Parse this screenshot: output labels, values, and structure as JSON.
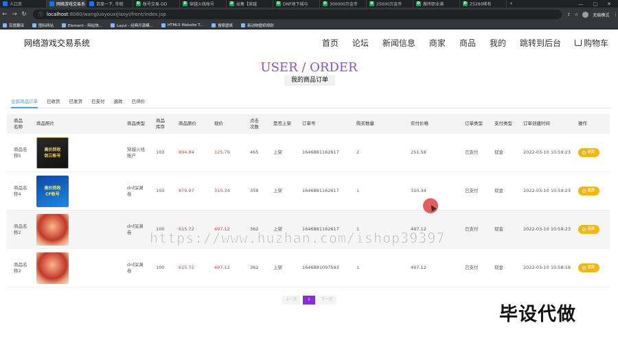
{
  "browser": {
    "tabs": [
      {
        "label": "人口页",
        "icon": "globe-icon",
        "active": false
      },
      {
        "label": "网络游戏交易系",
        "icon": "globe-icon",
        "active": true
      },
      {
        "label": "百度一下, 你就",
        "icon": "globe-icon",
        "active": false
      },
      {
        "label": "帐号交易-DD",
        "icon": "d-icon",
        "active": false
      },
      {
        "label": "穿越火线账号",
        "icon": "d-icon",
        "active": false
      },
      {
        "label": "出售【穿越",
        "icon": "d-icon",
        "active": false
      },
      {
        "label": "DNF地下城与",
        "icon": "d-icon",
        "active": false
      },
      {
        "label": "300000万金币",
        "icon": "d-icon",
        "active": false
      },
      {
        "label": "25000万金币",
        "icon": "d-icon",
        "active": false
      },
      {
        "label": "搬砖职业满",
        "icon": "d-icon",
        "active": false
      },
      {
        "label": "Z5280稀有",
        "icon": "d-icon",
        "active": false
      }
    ],
    "url_host": "localhost",
    "url_path": ":8080/wangluoyouxijiaoyi/front/index.jsp",
    "profile_label": "无痕模式",
    "bookmarks": [
      "百度翻译",
      "图标网站",
      "Element - 网站快...",
      "Layui - 经典开源模...",
      "HTML5 Website T...",
      "搜索壁纸",
      "新动物壁纸规则"
    ]
  },
  "site": {
    "logo": "网络游戏交易系统",
    "nav": [
      "首页",
      "论坛",
      "新闻信息",
      "商家",
      "商品",
      "我的",
      "跳转到后台",
      "购物车"
    ]
  },
  "page": {
    "title": "USER / ORDER",
    "subtitle": "我的商品订单",
    "filter_tabs": [
      "全部商品订单",
      "已收货",
      "已发货",
      "已支付",
      "退款",
      "已评价"
    ],
    "active_tab": 0
  },
  "table": {
    "headers": [
      "商品名称",
      "商品照片",
      "商品类型",
      "商品库存",
      "商品原价",
      "现价",
      "点击次数",
      "是否上架",
      "订单号",
      "购买数量",
      "实付价格",
      "订单类型",
      "支付类型",
      "订单创建时间",
      "操作"
    ],
    "rows": [
      {
        "name": "商品名称5",
        "image": "cf-account-black",
        "img_text": [
          "高价回收",
          "剑三帐号"
        ],
        "type": "穿越火线账户",
        "stock": "103",
        "orig": "894.84",
        "price": "125.79",
        "clicks": "465",
        "onsale": "上架",
        "order_no": "1646881162617",
        "qty": "2",
        "paid": "251.58",
        "order_type": "已支付",
        "pay_type": "现金",
        "created": "2022-03-10 10:59:23",
        "action": "退款"
      },
      {
        "name": "商品名称4",
        "image": "cf-account-blue",
        "img_text": [
          "高价回收",
          "CF帐号"
        ],
        "type": "dnf深渊卷",
        "stock": "103",
        "orig": "879.97",
        "price": "310.34",
        "clicks": "358",
        "onsale": "上架",
        "order_no": "1646881162617",
        "qty": "1",
        "paid": "310.34",
        "order_type": "已支付",
        "pay_type": "现金",
        "created": "2022-03-10 10:59:23",
        "action": "退款"
      },
      {
        "name": "商品名称2",
        "image": "dnf-character",
        "img_text": [],
        "type": "dnf深渊卷",
        "stock": "100",
        "orig": "615.72",
        "price": "497.12",
        "clicks": "362",
        "onsale": "上架",
        "order_no": "1646881162617",
        "qty": "1",
        "paid": "497.12",
        "order_type": "已支付",
        "pay_type": "现金",
        "created": "2022-03-10 10:59:23",
        "action": "退款"
      },
      {
        "name": "商品名称2",
        "image": "dnf-character",
        "img_text": [],
        "type": "dnf深渊卷",
        "stock": "100",
        "orig": "615.72",
        "price": "497.12",
        "clicks": "362",
        "onsale": "上架",
        "order_no": "1646881097593",
        "qty": "1",
        "paid": "497.12",
        "order_type": "已支付",
        "pay_type": "现金",
        "created": "2022-03-10 10:58:18",
        "action": "退款"
      }
    ]
  },
  "pager": {
    "prev": "上一页",
    "current": "1",
    "next": "下一页"
  },
  "overlay": {
    "watermark": "https://www.huzhan.com/ishop39397",
    "stamp": "毕设代做"
  },
  "colors": {
    "accent": "#8a4fd0",
    "price_red": "#e53935",
    "button_yellow": "#f5b70f",
    "tab_blue": "#409eff"
  }
}
